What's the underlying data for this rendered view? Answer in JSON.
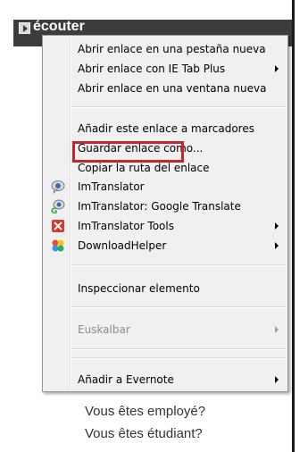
{
  "header": {
    "title": "écouter"
  },
  "menu": {
    "items": [
      {
        "label": "Abrir enlace en una pestaña nueva",
        "submenu": false,
        "disabled": false
      },
      {
        "label": "Abrir enlace con IE Tab Plus",
        "submenu": true,
        "disabled": false
      },
      {
        "label": "Abrir enlace en una ventana nueva",
        "submenu": false,
        "disabled": false
      },
      {
        "label": "Añadir este enlace a marcadores",
        "submenu": false,
        "disabled": false
      },
      {
        "label": "Guardar enlace como...",
        "submenu": false,
        "disabled": false,
        "highlighted": true
      },
      {
        "label": "Copiar la ruta del enlace",
        "submenu": false,
        "disabled": false
      },
      {
        "label": "ImTranslator",
        "submenu": false,
        "disabled": false,
        "icon": "translator-icon"
      },
      {
        "label": "ImTranslator: Google Translate",
        "submenu": false,
        "disabled": false,
        "icon": "google-translate-icon"
      },
      {
        "label": "ImTranslator Tools",
        "submenu": true,
        "disabled": false,
        "icon": "translator-tools-icon"
      },
      {
        "label": "DownloadHelper",
        "submenu": true,
        "disabled": false,
        "icon": "downloadhelper-icon"
      },
      {
        "label": "Inspeccionar elemento",
        "submenu": false,
        "disabled": false
      },
      {
        "label": "Euskalbar",
        "submenu": true,
        "disabled": true
      },
      {
        "label": "Añadir a Evernote",
        "submenu": true,
        "disabled": false
      }
    ]
  },
  "page_links": [
    "Vous êtes employé?",
    "Vous êtes étudiant?"
  ],
  "colors": {
    "header_bg": "#3c3c3c",
    "menu_bg": "#f0f0f0",
    "highlight_border": "#c0282e"
  }
}
